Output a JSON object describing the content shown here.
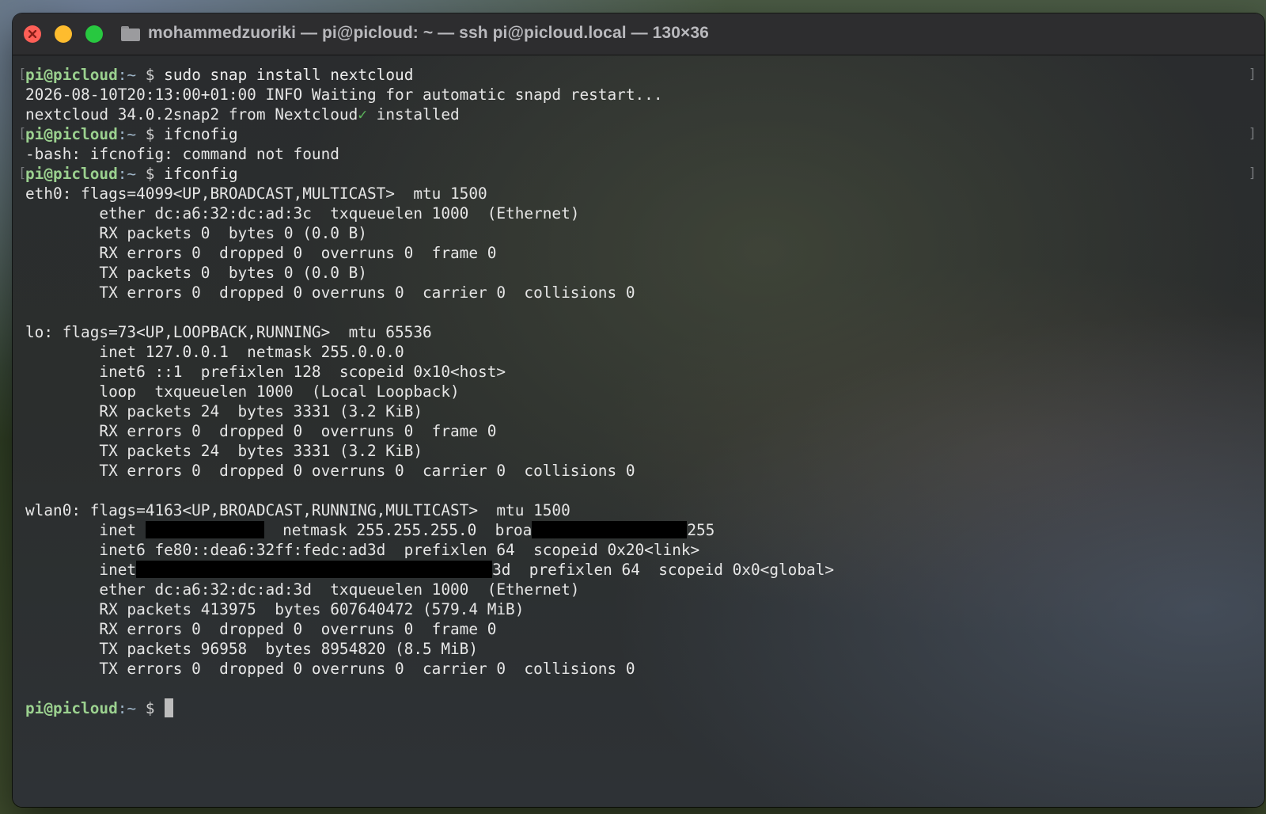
{
  "window": {
    "title": "mohammedzuoriki — pi@picloud: ~ — ssh pi@picloud.local — 130×36"
  },
  "prompt": {
    "user_host": "pi@picloud",
    "path": ":~",
    "symbol": "$"
  },
  "session": {
    "cmd1": "sudo snap install nextcloud",
    "info_line": "2026-08-10T20:13:00+01:00 INFO Waiting for automatic snapd restart...",
    "installed_a": "nextcloud 34.0.2snap2 from Nextcloud",
    "installed_check": "✓",
    "installed_b": " installed",
    "cmd2": "ifcnofig",
    "error_line": "-bash: ifcnofig: command not found",
    "cmd3": "ifconfig"
  },
  "eth0": {
    "header": "eth0: flags=4099<UP,BROADCAST,MULTICAST>  mtu 1500",
    "ether": "        ether dc:a6:32:dc:ad:3c  txqueuelen 1000  (Ethernet)",
    "rx_packets": "        RX packets 0  bytes 0 (0.0 B)",
    "rx_errors": "        RX errors 0  dropped 0  overruns 0  frame 0",
    "tx_packets": "        TX packets 0  bytes 0 (0.0 B)",
    "tx_errors": "        TX errors 0  dropped 0 overruns 0  carrier 0  collisions 0"
  },
  "lo": {
    "header": "lo: flags=73<UP,LOOPBACK,RUNNING>  mtu 65536",
    "inet": "        inet 127.0.0.1  netmask 255.0.0.0",
    "inet6": "        inet6 ::1  prefixlen 128  scopeid 0x10<host>",
    "loop": "        loop  txqueuelen 1000  (Local Loopback)",
    "rx_packets": "        RX packets 24  bytes 3331 (3.2 KiB)",
    "rx_errors": "        RX errors 0  dropped 0  overruns 0  frame 0",
    "tx_packets": "        TX packets 24  bytes 3331 (3.2 KiB)",
    "tx_errors": "        TX errors 0  dropped 0 overruns 0  carrier 0  collisions 0"
  },
  "wlan0": {
    "header": "wlan0: flags=4163<UP,BROADCAST,RUNNING,MULTICAST>  mtu 1500",
    "inet_a": "        inet ",
    "inet_b": "  netmask 255.255.255.0  broa",
    "inet_c": "255",
    "inet6_link": "        inet6 fe80::dea6:32ff:fedc:ad3d  prefixlen 64  scopeid 0x20<link>",
    "inet6_global_a": "        inet",
    "inet6_global_b": "3d  prefixlen 64  scopeid 0x0<global>",
    "ether": "        ether dc:a6:32:dc:ad:3d  txqueuelen 1000  (Ethernet)",
    "rx_packets": "        RX packets 413975  bytes 607640472 (579.4 MiB)",
    "rx_errors": "        RX errors 0  dropped 0  overruns 0  frame 0",
    "tx_packets": "        TX packets 96958  bytes 8954820 (8.5 MiB)",
    "tx_errors": "        TX errors 0  dropped 0 overruns 0  carrier 0  collisions 0"
  },
  "colors": {
    "prompt_user": "#9bd18f",
    "prompt_path": "#9fb6c9",
    "close": "#fe5f57",
    "minimize": "#febc2e",
    "zoom": "#28c840"
  }
}
